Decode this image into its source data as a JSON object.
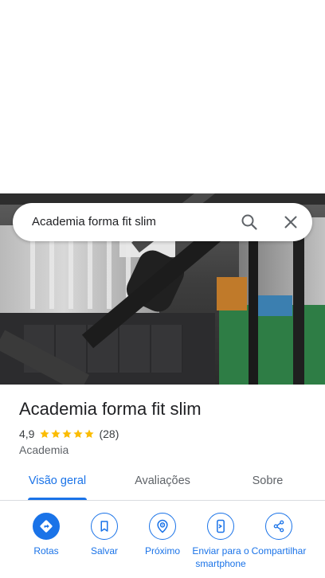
{
  "search": {
    "query": "Academia forma fit slim"
  },
  "place": {
    "name": "Academia forma fit slim",
    "rating": "4,9",
    "stars": 5,
    "review_count": "(28)",
    "category": "Academia"
  },
  "tabs": [
    {
      "label": "Visão geral",
      "active": true
    },
    {
      "label": "Avaliações",
      "active": false
    },
    {
      "label": "Sobre",
      "active": false
    }
  ],
  "actions": [
    {
      "label": "Rotas",
      "icon": "directions-icon"
    },
    {
      "label": "Salvar",
      "icon": "bookmark-icon"
    },
    {
      "label": "Próximo",
      "icon": "nearby-icon"
    },
    {
      "label": "Enviar para o smartphone",
      "icon": "send-to-phone-icon"
    },
    {
      "label": "Compartilhar",
      "icon": "share-icon"
    }
  ],
  "colors": {
    "accent": "#1a73e8",
    "star": "#fbbc04",
    "text": "#202124",
    "secondary": "#5f6368"
  }
}
